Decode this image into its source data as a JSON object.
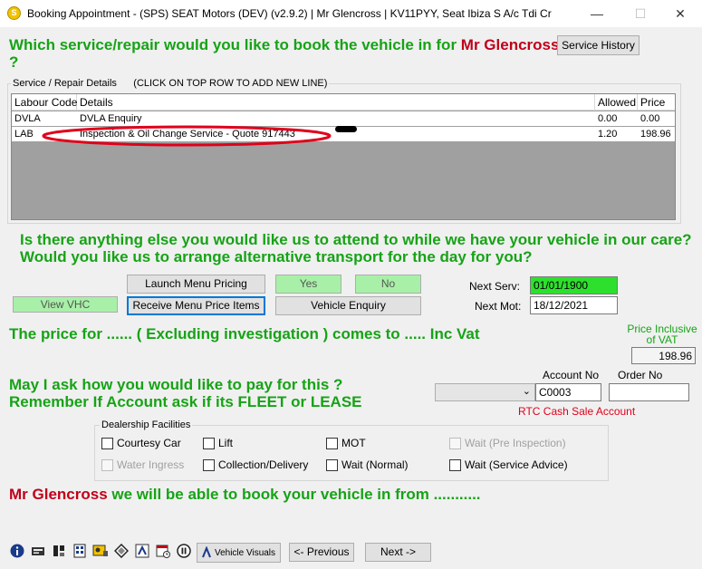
{
  "window": {
    "title": "Booking Appointment - (SPS) SEAT Motors (DEV) (v2.9.2) | Mr Glencross | KV11PYY, Seat Ibiza S A/c Tdi Cr",
    "minimize": "—",
    "maximize": "☐",
    "close": "✕"
  },
  "question1": {
    "prefix": "Which service/repair would you like to book the vehicle in for",
    "customer": "Mr Glencross",
    "suffix": "?"
  },
  "service_history_button": "Service History",
  "grid": {
    "group_label": "Service / Repair Details",
    "hint": "(CLICK ON TOP ROW TO ADD NEW LINE)",
    "columns": [
      "Labour Code",
      "Details",
      "Allowed",
      "Price"
    ],
    "rows": [
      {
        "code": "DVLA",
        "details": "DVLA Enquiry",
        "allowed": "0.00",
        "price": "0.00"
      },
      {
        "code": "LAB",
        "details": "Inspection & Oil Change Service - Quote 917443",
        "allowed": "1.20",
        "price": "198.96"
      }
    ]
  },
  "question2": {
    "line1": "Is there anything else you would like us to attend to while we have your vehicle in our care?",
    "line2": "Would you like us to arrange alternative transport for the day for you?"
  },
  "buttons": {
    "launch_menu_pricing": "Launch Menu Pricing",
    "yes": "Yes",
    "no": "No",
    "view_vhc": "View VHC",
    "receive_menu_price_items": "Receive Menu Price Items",
    "vehicle_enquiry": "Vehicle Enquiry",
    "vehicle_visuals": "Vehicle Visuals",
    "previous": "<- Previous",
    "next": "Next ->"
  },
  "next_serv": {
    "label": "Next Serv:",
    "value": "01/01/1900"
  },
  "next_mot": {
    "label": "Next Mot:",
    "value": "18/12/2021"
  },
  "price_statement": "The price for ...... ( Excluding investigation ) comes to ..... Inc Vat",
  "price_inclusive": {
    "label_line1": "Price Inclusive",
    "label_line2": "of VAT",
    "value": "198.96"
  },
  "payment": {
    "line1": "May I ask how you would like to pay for this ?",
    "line2": "Remember If Account  ask if its FLEET or LEASE",
    "dropdown_value": "",
    "account_no_label": "Account No",
    "account_no_value": "C0003",
    "order_no_label": "Order No",
    "order_no_value": "",
    "account_name": "RTC Cash Sale Account"
  },
  "facilities": {
    "group_label": "Dealership Facilities",
    "items": [
      {
        "label": "Courtesy Car"
      },
      {
        "label": "Lift"
      },
      {
        "label": "MOT"
      },
      {
        "label": "Wait (Pre Inspection)"
      },
      {
        "label": "Water Ingress"
      },
      {
        "label": "Collection/Delivery"
      },
      {
        "label": "Wait (Normal)"
      },
      {
        "label": "Wait (Service Advice)"
      }
    ]
  },
  "booking_statement": {
    "customer": "Mr Glencross",
    "text": "we will be able to book your vehicle in from ..........."
  },
  "colors": {
    "green_text": "#16a316",
    "red_text": "#c0001a",
    "annotation_oval": "#e0001b",
    "green_field": "#2ee02e",
    "green_button": "#a8f0a8"
  }
}
